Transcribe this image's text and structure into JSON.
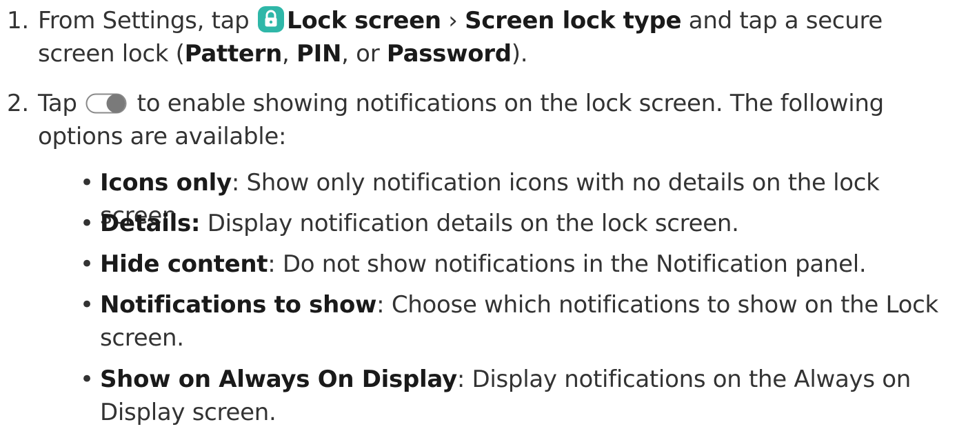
{
  "steps": [
    {
      "number": "1.",
      "parts": {
        "p1": "From Settings, tap ",
        "lock_screen": "Lock screen",
        "sep": " › ",
        "screen_lock_type": "Screen lock type",
        "p2": " and tap a secure screen lock (",
        "pattern": "Pattern",
        "comma1": ", ",
        "pin": "PIN",
        "or": ", or ",
        "password": "Password",
        "end": ")."
      }
    },
    {
      "number": "2.",
      "parts": {
        "p1": "Tap ",
        "p2": " to enable showing notifications on the lock screen. The following options are available:"
      }
    }
  ],
  "options": [
    {
      "label": "Icons only",
      "desc": ": Show only notification icons with no details on the lock screen."
    },
    {
      "label": "Details:",
      "desc": " Display notification details on the lock screen."
    },
    {
      "label": "Hide content",
      "desc": ": Do not show notifications in the Notification panel."
    },
    {
      "label": "Notifications to show",
      "desc": ": Choose which notifications to show on the Lock screen."
    },
    {
      "label": "Show on Always On Display",
      "desc": ": Display notifications on the Always on Display screen."
    }
  ],
  "bullet_char": "•",
  "icons": {
    "lock": "lock-icon",
    "toggle": "toggle-switch-icon"
  },
  "colors": {
    "text": "#333333",
    "bold_text": "#1a1a1a",
    "lock_icon_bg": "#2fb7a8",
    "toggle_track": "#9e9e9e",
    "toggle_knob": "#7a7a7a"
  }
}
